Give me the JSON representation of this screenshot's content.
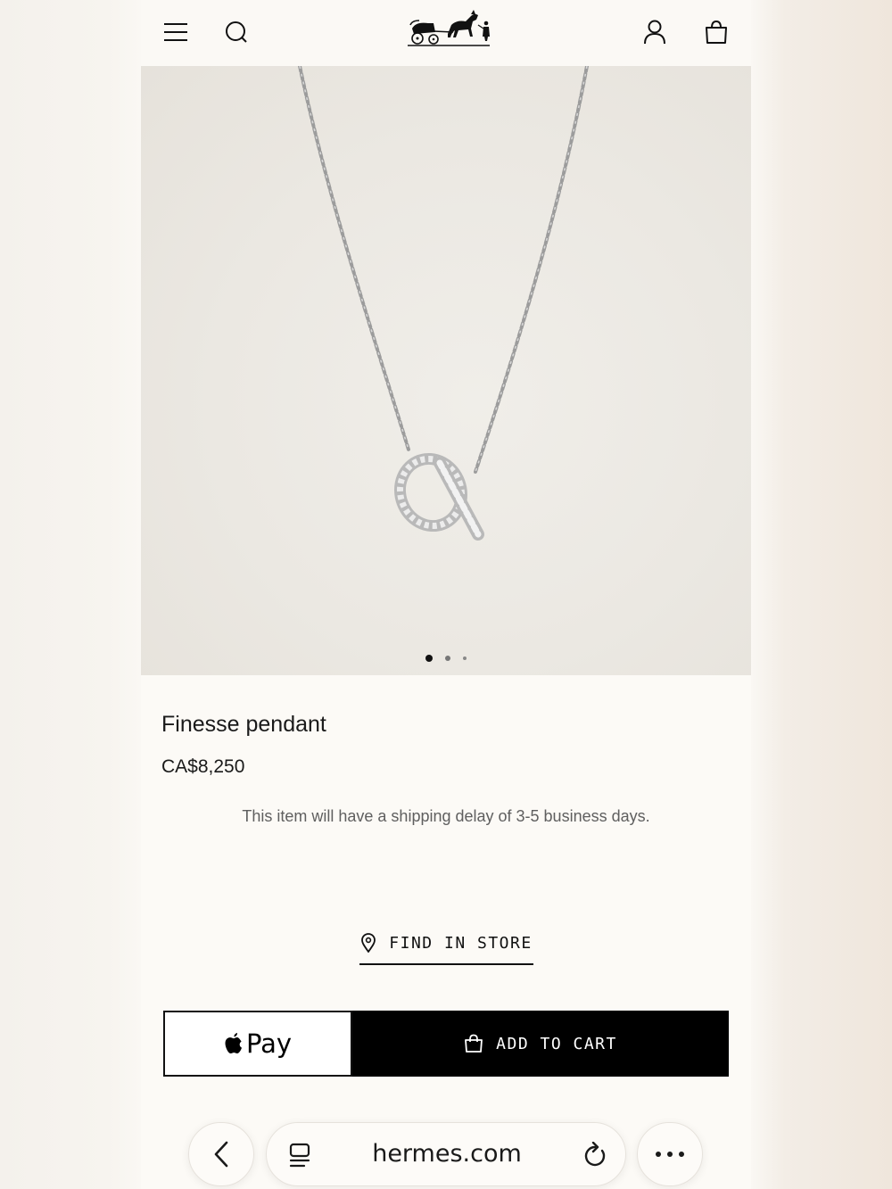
{
  "header": {
    "menu_icon": "hamburger-menu-icon",
    "search_icon": "search-icon",
    "logo": "horse-carriage-logo",
    "account_icon": "user-icon",
    "cart_icon": "shopping-bag-icon"
  },
  "gallery": {
    "slide_count": 3,
    "active_slide": 1
  },
  "product": {
    "title": "Finesse pendant",
    "price": "CA$8,250",
    "shipping_note": "This item will have a shipping delay of 3-5 business days."
  },
  "actions": {
    "find_in_store": "FIND IN STORE",
    "apple_pay": "Pay",
    "add_to_cart": "ADD TO CART"
  },
  "browser": {
    "url": "hermes.com",
    "back_icon": "chevron-left-icon",
    "tabs_icon": "tabs-icon",
    "reload_icon": "reload-icon",
    "more_icon": "more-dots-icon"
  },
  "colors": {
    "background": "#fcfaf6",
    "text": "#1a1a1a",
    "button_dark": "#000000"
  }
}
